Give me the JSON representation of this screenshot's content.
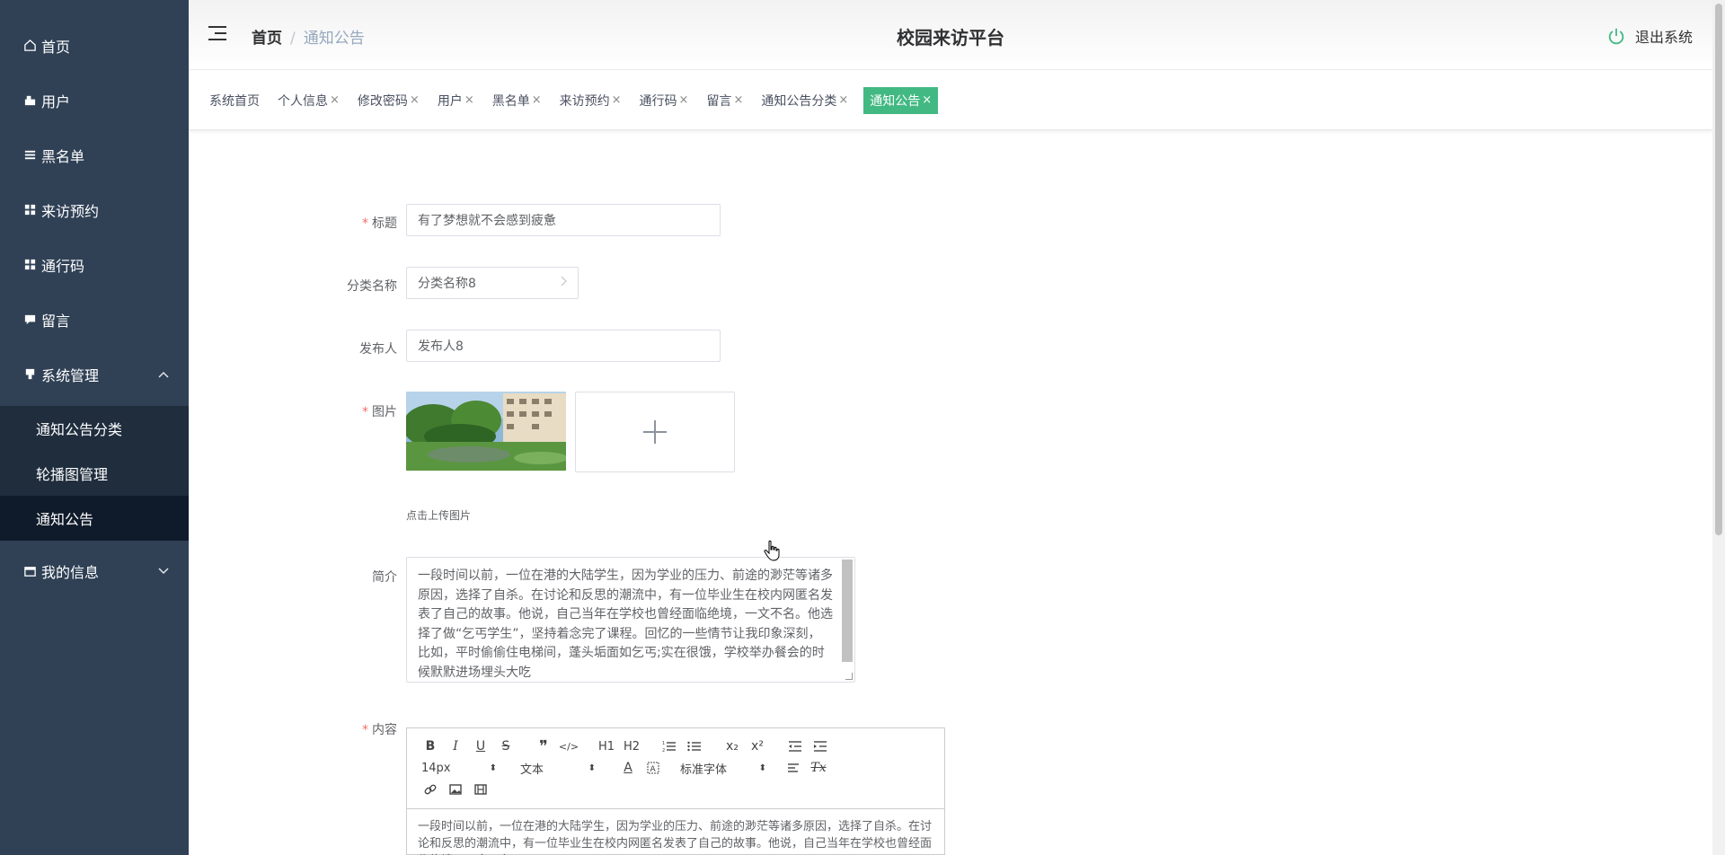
{
  "sidebar": {
    "items": [
      {
        "label": "首页",
        "icon": "home-icon"
      },
      {
        "label": "用户",
        "icon": "user-icon"
      },
      {
        "label": "黑名单",
        "icon": "list-icon"
      },
      {
        "label": "来访预约",
        "icon": "grid-icon"
      },
      {
        "label": "通行码",
        "icon": "grid-icon"
      },
      {
        "label": "留言",
        "icon": "comment-icon"
      },
      {
        "label": "系统管理",
        "icon": "settings-icon"
      }
    ],
    "sub_items": [
      "通知公告分类",
      "轮播图管理",
      "通知公告"
    ],
    "my_info": "我的信息"
  },
  "header": {
    "breadcrumb_home": "首页",
    "breadcrumb_current": "通知公告",
    "title": "校园来访平台",
    "logout": "退出系统"
  },
  "tags": [
    {
      "label": "系统首页",
      "closable": false
    },
    {
      "label": "个人信息",
      "closable": true
    },
    {
      "label": "修改密码",
      "closable": true
    },
    {
      "label": "用户",
      "closable": true
    },
    {
      "label": "黑名单",
      "closable": true
    },
    {
      "label": "来访预约",
      "closable": true
    },
    {
      "label": "通行码",
      "closable": true
    },
    {
      "label": "留言",
      "closable": true
    },
    {
      "label": "通知公告分类",
      "closable": true
    },
    {
      "label": "通知公告",
      "closable": true,
      "active": true
    }
  ],
  "close_glyph": "×",
  "form": {
    "title_label": "标题",
    "title_value": "有了梦想就不会感到疲惫",
    "category_label": "分类名称",
    "category_value": "分类名称8",
    "publisher_label": "发布人",
    "publisher_value": "发布人8",
    "image_label": "图片",
    "upload_hint": "点击上传图片",
    "intro_label": "简介",
    "intro_value": "一段时间以前，一位在港的大陆学生，因为学业的压力、前途的渺茫等诸多原因，选择了自杀。在讨论和反思的潮流中，有一位毕业生在校内网匿名发表了自己的故事。他说，自己当年在学校也曾经面临绝境，一文不名。他选择了做“乞丐学生”，坚持着念完了课程。回忆的一些情节让我印象深刻，比如，平时偷偷住电梯间，蓬头垢面如乞丐;实在很饿，学校举办餐会的时候默默进场埋头大吃",
    "content_label": "内容",
    "content_value": "一段时间以前，一位在港的大陆学生，因为学业的压力、前途的渺茫等诸多原因，选择了自杀。在讨论和反思的潮流中，有一位毕业生在校内网匿名发表了自己的故事。他说，自己当年在学校也曾经面临绝境，一文不名。"
  },
  "editor": {
    "size": "14px",
    "header_picker": "文本",
    "font_picker": "标准字体",
    "h1": "H1",
    "h2": "H2",
    "sub": "x₂",
    "sup": "x²",
    "bold": "B",
    "italic": "I",
    "underline": "U",
    "strike": "S",
    "quote": "❞",
    "code": "</>",
    "color": "A",
    "clean": "Tx"
  },
  "colors": {
    "sidebar": "#304156",
    "accent": "#42b983",
    "required": "#f56c6c"
  }
}
